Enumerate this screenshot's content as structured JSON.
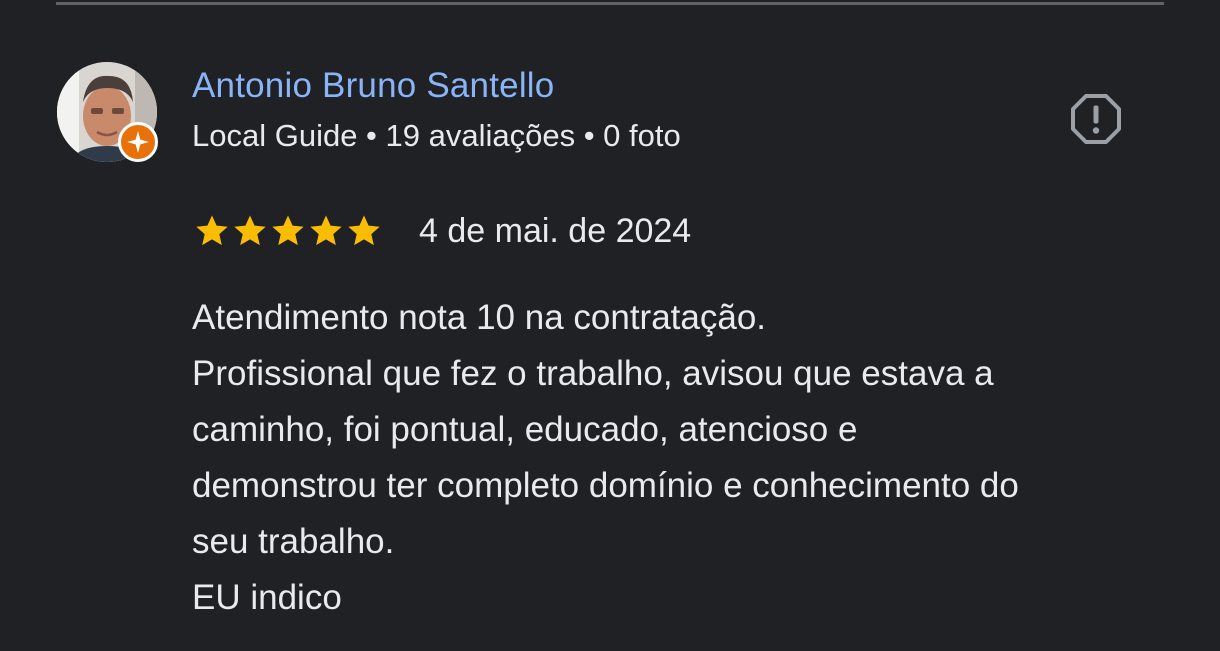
{
  "review": {
    "reviewer": {
      "name": "Antonio Bruno Santello",
      "meta": "Local Guide • 19 avaliações • 0 foto",
      "badge": "local-guide-badge-icon"
    },
    "rating": 5,
    "rating_max": 5,
    "date": "4 de mai. de 2024",
    "text_lines": [
      "Atendimento nota 10 na contratação.",
      "Profissional que fez o trabalho, avisou que estava a",
      "caminho, foi pontual, educado, atencioso e",
      "demonstrou ter completo domínio e conhecimento do",
      "seu trabalho.",
      "EU indico"
    ]
  },
  "icons": {
    "report": "report-icon",
    "star": "star-icon"
  },
  "colors": {
    "background": "#202124",
    "name_link": "#8ab4f8",
    "text": "#e8eaed",
    "star": "#fbbc04",
    "badge": "#e8710a",
    "icon": "#9aa0a6"
  }
}
